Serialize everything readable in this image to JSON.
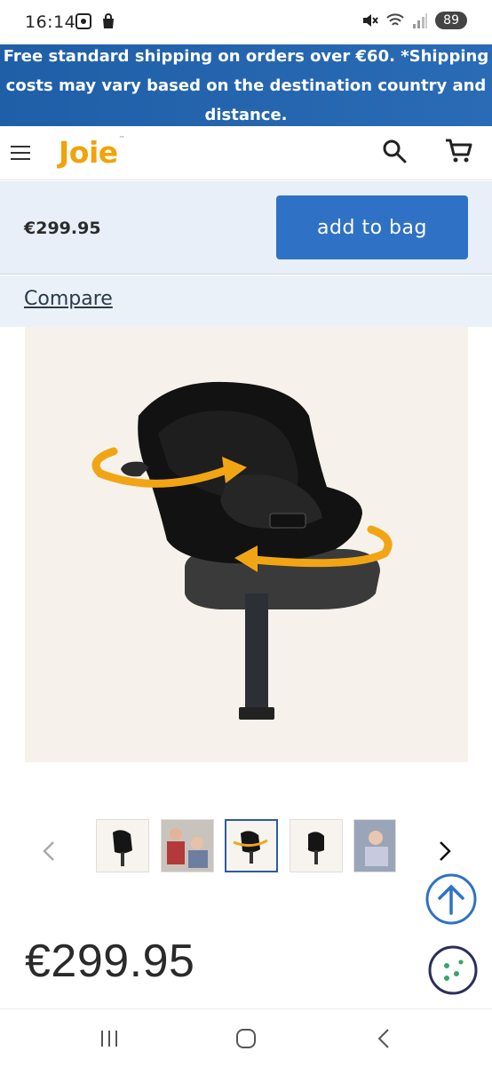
{
  "status_bar": {
    "time": "16:14",
    "battery": "89"
  },
  "promo": {
    "text": "Free standard shipping on orders over €60. *Shipping costs may vary based on the destination country and distance."
  },
  "header": {
    "logo": "Joie"
  },
  "buy_bar": {
    "price": "€299.95",
    "add_to_bag": "add to bag"
  },
  "compare": {
    "label": "Compare"
  },
  "gallery": {
    "thumbnail_count": 5,
    "active_index": 2
  },
  "product": {
    "price": "€299.95"
  },
  "colors": {
    "promo_bg": "#1f5fa8",
    "accent_blue": "#2f72c5",
    "logo_orange": "#f0a30a",
    "rotation_arrow": "#f2a514"
  }
}
